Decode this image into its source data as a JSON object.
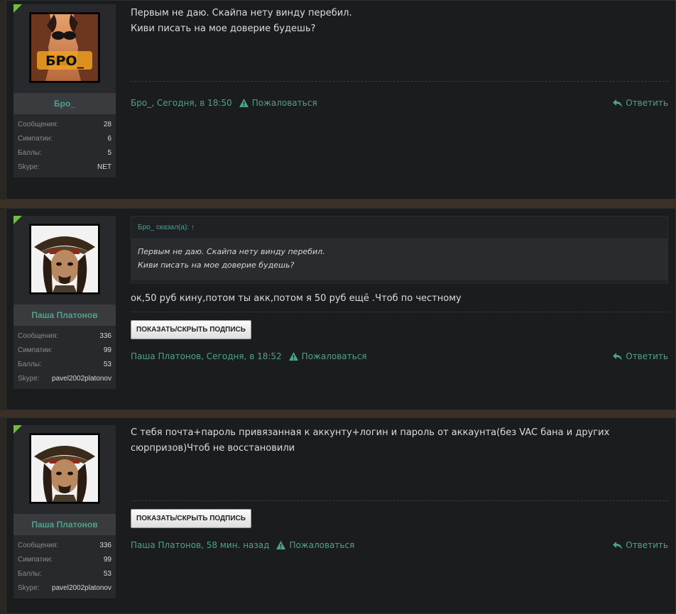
{
  "labels": {
    "messages": "Сообщения:",
    "likes": "Симпатии:",
    "points": "Баллы:",
    "skype": "Skype:",
    "report": "Пожаловаться",
    "reply": "Ответить",
    "toggle_signature": "ПОКАЗАТЬ/СКРЫТЬ ПОДПИСЬ"
  },
  "colors": {
    "accent": "#4fa28a",
    "corner": "#6fbe3a",
    "post_bg": "#1b1c1e",
    "page_bg": "#2a2622"
  },
  "posts": [
    {
      "author": "Бро_",
      "avatar_caption": "БРО_",
      "stats": {
        "messages": "28",
        "likes": "6",
        "points": "5",
        "skype": "NET"
      },
      "lines": [
        "Первым не даю. Скайпа нету винду перебил.",
        "Киви писать на мое доверие будешь?"
      ],
      "date": "Бро_, Сегодня, в 18:50"
    },
    {
      "author": "Паша Платонов",
      "stats": {
        "messages": "336",
        "likes": "99",
        "points": "53",
        "skype": "pavel2002platonov"
      },
      "quote": {
        "header": "Бро_ сказал(а): ↑",
        "lines": [
          "Первым не даю. Скайпа нету винду перебил.",
          "Киви писать на мое доверие будешь?"
        ]
      },
      "lines": [
        "ок,50 руб кину,потом ты акк,потом я 50 руб ещё .Чтоб по честному"
      ],
      "date": "Паша Платонов, Сегодня, в 18:52"
    },
    {
      "author": "Паша Платонов",
      "stats": {
        "messages": "336",
        "likes": "99",
        "points": "53",
        "skype": "pavel2002platonov"
      },
      "lines": [
        "С тебя почта+пароль привязанная к аккунту+логин и пароль от аккаунта(без VAC бана и других",
        "сюрпризов)Чтоб не восстановили"
      ],
      "date": "Паша Платонов, 58 мин. назад"
    }
  ]
}
